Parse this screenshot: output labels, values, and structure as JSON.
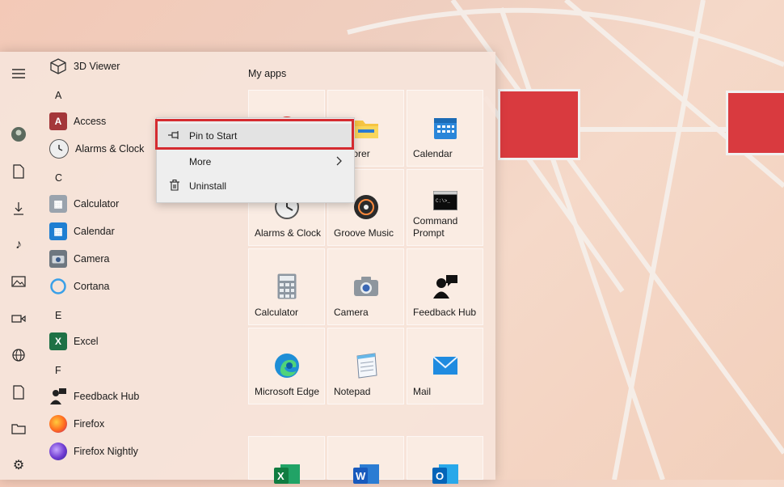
{
  "app_list": {
    "top_item": "3D Viewer",
    "sections": [
      {
        "letter": "A",
        "items": [
          "Access",
          "Alarms & Clock"
        ]
      },
      {
        "letter": "C",
        "items": [
          "Calculator",
          "Calendar",
          "Camera",
          "Cortana"
        ]
      },
      {
        "letter": "E",
        "items": [
          "Excel"
        ]
      },
      {
        "letter": "F",
        "items": [
          "Feedback Hub",
          "Firefox",
          "Firefox Nightly"
        ]
      }
    ]
  },
  "tiles": {
    "group_title": "My apps",
    "items": [
      {
        "label": "",
        "icon": "red-app-icon"
      },
      {
        "label": "Explorer",
        "icon": "folder-icon"
      },
      {
        "label": "Calendar",
        "icon": "calendar-icon"
      },
      {
        "label": "Alarms & Clock",
        "icon": "clock-icon"
      },
      {
        "label": "Groove Music",
        "icon": "music-disc-icon"
      },
      {
        "label": "Command Prompt",
        "icon": "terminal-icon"
      },
      {
        "label": "Calculator",
        "icon": "calculator-icon"
      },
      {
        "label": "Camera",
        "icon": "camera-icon"
      },
      {
        "label": "Feedback Hub",
        "icon": "feedback-icon"
      },
      {
        "label": "Microsoft Edge",
        "icon": "edge-icon"
      },
      {
        "label": "Notepad",
        "icon": "notepad-icon"
      },
      {
        "label": "Mail",
        "icon": "mail-icon"
      }
    ]
  },
  "context_menu": {
    "pin_label": "Pin to Start",
    "more_label": "More",
    "uninstall_label": "Uninstall"
  },
  "colors": {
    "highlight_border": "#d52b30",
    "accent": "#0078d4"
  }
}
